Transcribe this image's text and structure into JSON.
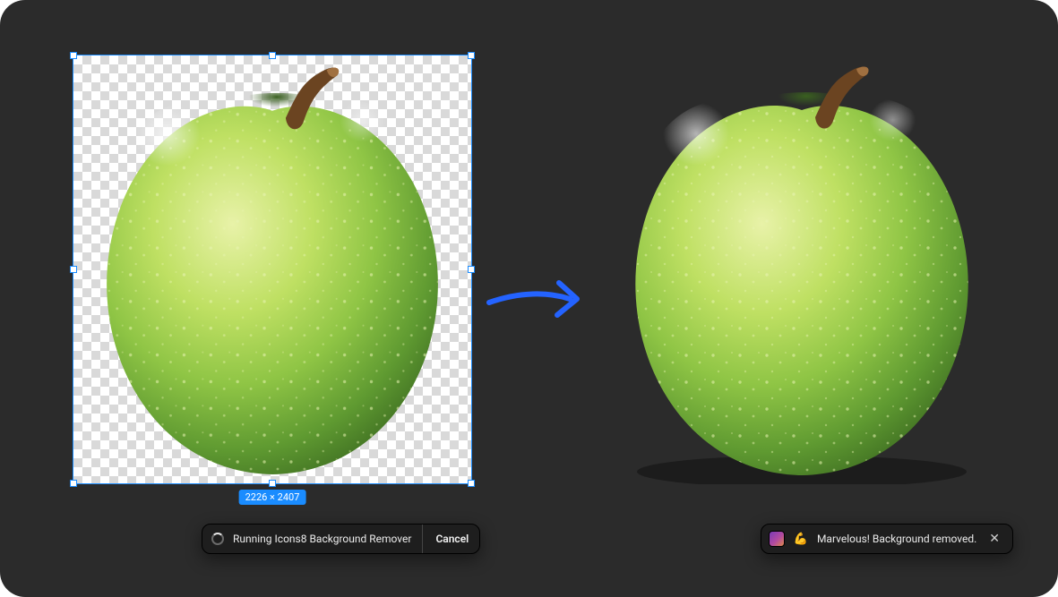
{
  "selection": {
    "dimensions_label": "2226 × 2407"
  },
  "status": {
    "running_text": "Running Icons8 Background Remover",
    "cancel_label": "Cancel"
  },
  "toast": {
    "emoji": "💪",
    "message": "Marvelous! Background removed.",
    "close_glyph": "✕"
  },
  "icons": {
    "arrow": "arrow-right",
    "spinner": "loading-spinner",
    "avatar": "plugin-avatar",
    "close": "close-icon"
  },
  "colors": {
    "selection_border": "#1a8cff",
    "canvas_bg": "#2b2b2b",
    "apple_body_light": "#cbe26a",
    "apple_body_dark": "#4f8a2a",
    "apple_stem": "#6b4421"
  }
}
